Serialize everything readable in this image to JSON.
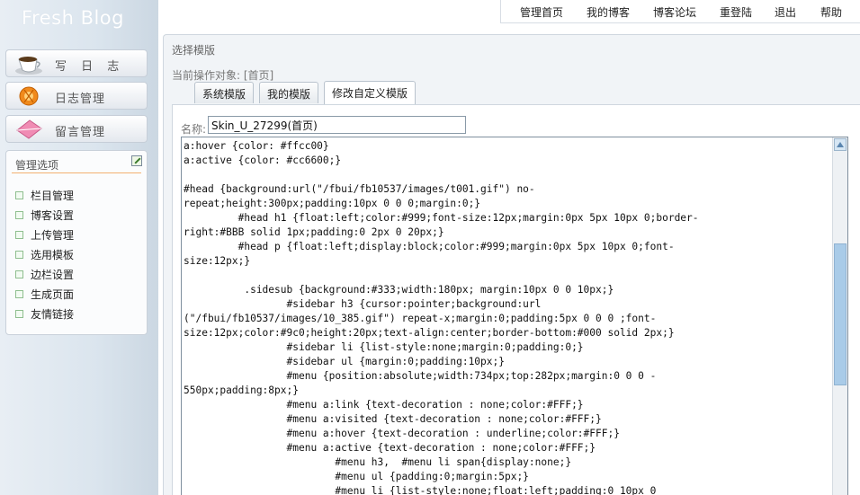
{
  "sidebar": {
    "logo": "Fresh Blog",
    "buttons": [
      {
        "label": "写 日 志",
        "icon": "coffee-cup-icon"
      },
      {
        "label": "日志管理",
        "icon": "orange-gear-icon"
      },
      {
        "label": "留言管理",
        "icon": "pink-envelope-icon"
      }
    ],
    "manage": {
      "title": "管理选项",
      "icon": "edit-icon",
      "items": [
        "栏目管理",
        "博客设置",
        "上传管理",
        "选用模板",
        "边栏设置",
        "生成页面",
        "友情链接"
      ]
    }
  },
  "topnav": {
    "items": [
      "管理首页",
      "我的博客",
      "博客论坛",
      "重登陆",
      "退出",
      "帮助"
    ]
  },
  "main": {
    "title": "选择模版",
    "target": "当前操作对象: [首页]",
    "tabs": [
      {
        "label": "系统模版",
        "active": false
      },
      {
        "label": "我的模版",
        "active": false
      },
      {
        "label": "修改自定义模版",
        "active": true
      }
    ],
    "name_label": "名称:",
    "name_value": "Skin_U_27299(首页)",
    "code": "a:hover {color: #ffcc00}\na:active {color: #cc6600;}\n\n#head {background:url(\"/fbui/fb10537/images/t001.gif\") no-\nrepeat;height:300px;padding:10px 0 0 0;margin:0;}\n         #head h1 {float:left;color:#999;font-size:12px;margin:0px 5px 10px 0;border-\nright:#BBB solid 1px;padding:0 2px 0 20px;}\n         #head p {float:left;display:block;color:#999;margin:0px 5px 10px 0;font-\nsize:12px;}\n\n          .sidesub {background:#333;width:180px; margin:10px 0 0 10px;}\n                 #sidebar h3 {cursor:pointer;background:url\n(\"/fbui/fb10537/images/10_385.gif\") repeat-x;margin:0;padding:5px 0 0 0 ;font-\nsize:12px;color:#9c0;height:20px;text-align:center;border-bottom:#000 solid 2px;}\n                 #sidebar li {list-style:none;margin:0;padding:0;}\n                 #sidebar ul {margin:0;padding:10px;}\n                 #menu {position:absolute;width:734px;top:282px;margin:0 0 0 -\n550px;padding:8px;}\n                 #menu a:link {text-decoration : none;color:#FFF;}\n                 #menu a:visited {text-decoration : none;color:#FFF;}\n                 #menu a:hover {text-decoration : underline;color:#FFF;}\n                 #menu a:active {text-decoration : none;color:#FFF;}\n                         #menu h3,  #menu li span{display:none;}\n                         #menu ul {padding:0;margin:5px;}\n                         #menu li {list-style:none;float:left;padding:0 10px 0"
  }
}
